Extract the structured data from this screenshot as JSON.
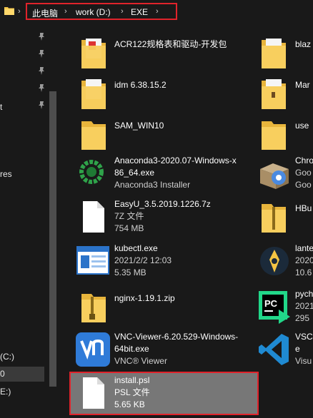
{
  "address": {
    "crumbs": [
      "此电脑",
      "work (D:)",
      "EXE"
    ]
  },
  "nav": {
    "items": [
      {
        "label": "t"
      },
      {
        "label": "res"
      },
      {
        "label": "(C:)"
      },
      {
        "label": "0"
      },
      {
        "label": "E:)"
      }
    ]
  },
  "files": [
    {
      "name": "ACR122规格表和驱动-开发包",
      "line2": "",
      "line3": "",
      "icon": "folder-icon-documents"
    },
    {
      "name": "idm 6.38.15.2",
      "line2": "",
      "line3": "",
      "icon": "folder-icon-documents"
    },
    {
      "name": "SAM_WIN10",
      "line2": "",
      "line3": "",
      "icon": "folder-icon"
    },
    {
      "name": "Anaconda3-2020.07-Windows-x",
      "line2": "86_64.exe",
      "line3": "Anaconda3 Installer",
      "icon": "anaconda-icon"
    },
    {
      "name": "EasyU_3.5.2019.1226.7z",
      "line2": "7Z 文件",
      "line3": "754 MB",
      "icon": "file-icon"
    },
    {
      "name": "kubectl.exe",
      "line2": "2021/2/2 12:03",
      "line3": "5.35 MB",
      "icon": "exe-window-icon"
    },
    {
      "name": "nginx-1.19.1.zip",
      "line2": "",
      "line3": "",
      "icon": "zip-folder-icon"
    },
    {
      "name": "VNC-Viewer-6.20.529-Windows-",
      "line2": "64bit.exe",
      "line3": "VNC® Viewer",
      "icon": "vnc-icon"
    },
    {
      "name": "install.psl",
      "line2": "PSL 文件",
      "line3": "5.65 KB",
      "icon": "file-icon"
    }
  ],
  "files_right": [
    {
      "name": "blaz",
      "line2": "",
      "line3": "",
      "icon": "folder-icon-documents"
    },
    {
      "name": "Mar",
      "line2": "",
      "line3": "",
      "icon": "folder-icon-documents"
    },
    {
      "name": "use",
      "line2": "",
      "line3": "",
      "icon": "folder-icon"
    },
    {
      "name": "Chro",
      "line2": "Goo",
      "line3": "Goo",
      "icon": "installer-box-icon"
    },
    {
      "name": "HBu",
      "line2": "",
      "line3": "",
      "icon": "zip-folder-icon"
    },
    {
      "name": "lante",
      "line2": "2020",
      "line3": "10.6",
      "icon": "lantern-icon"
    },
    {
      "name": "pych",
      "line2": "2021",
      "line3": "295",
      "icon": "pycharm-icon"
    },
    {
      "name": "VSCo",
      "line2": "e",
      "line3": "Visu",
      "icon": "vscode-icon"
    }
  ]
}
